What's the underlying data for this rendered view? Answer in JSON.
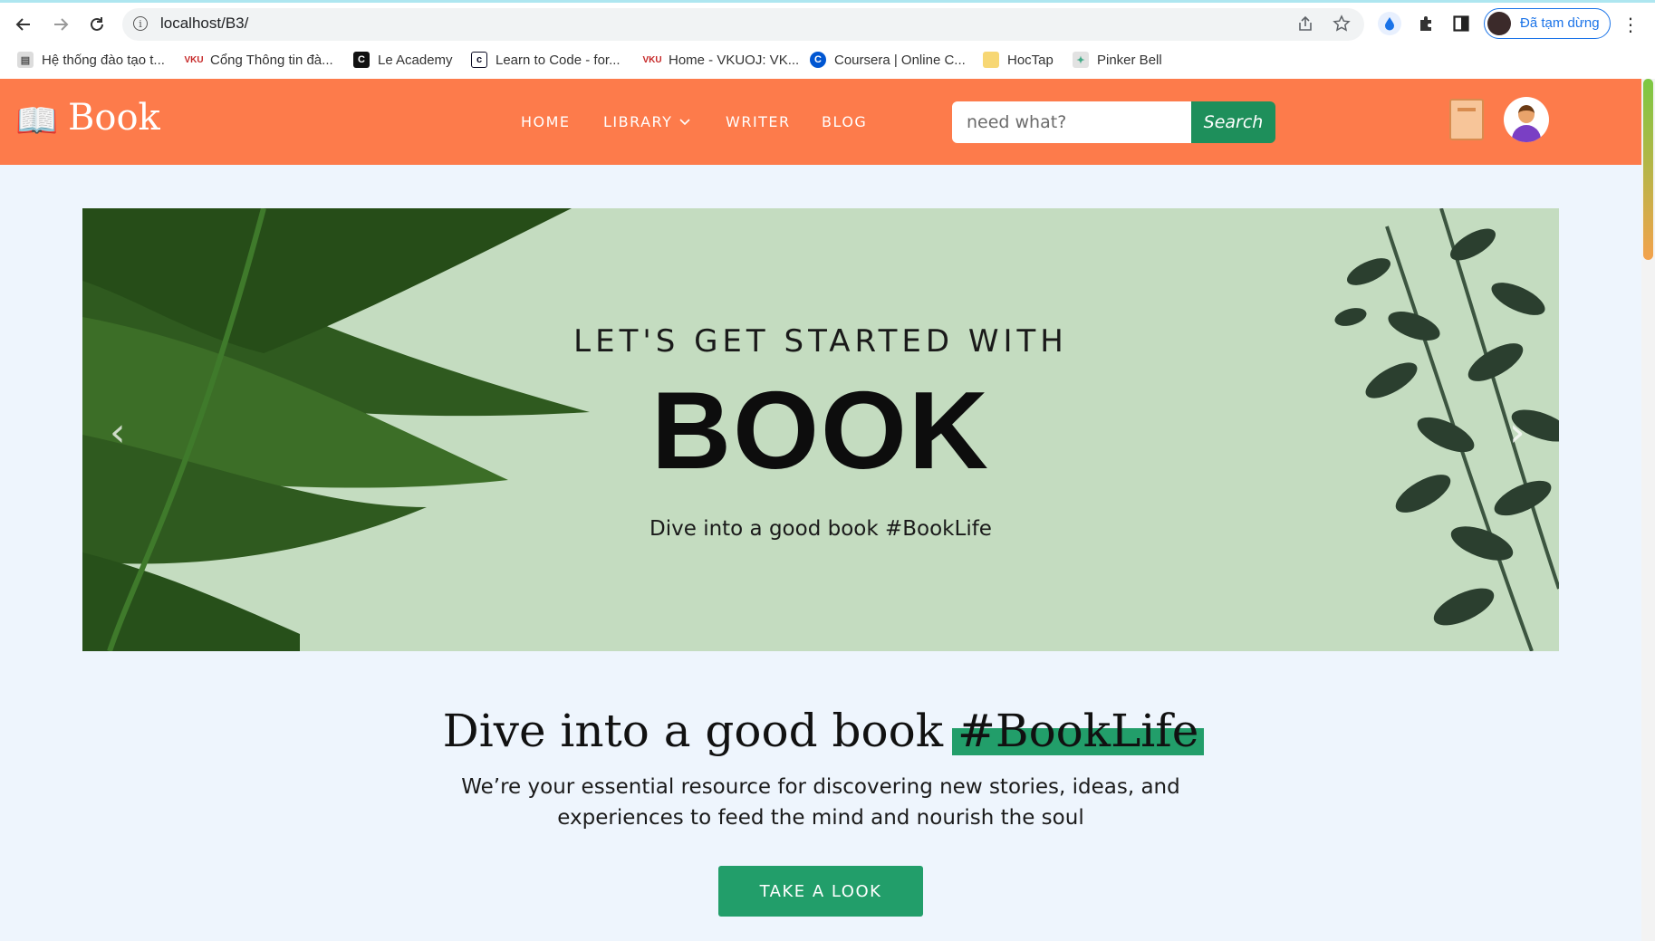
{
  "browser": {
    "url": "localhost/B3/",
    "profile_status": "Đã tạm dừng",
    "bookmarks": [
      {
        "label": "Hệ thống đào tạo t...",
        "icon": "page-icon"
      },
      {
        "label": "Cổng Thông tin đà...",
        "icon": "vku-icon"
      },
      {
        "label": "Le Academy",
        "icon": "c-icon"
      },
      {
        "label": "Learn to Code - for...",
        "icon": "code-icon"
      },
      {
        "label": "Home - VKUOJ: VK...",
        "icon": "vku-icon"
      },
      {
        "label": "Coursera | Online C...",
        "icon": "coursera-icon"
      },
      {
        "label": "HocTap",
        "icon": "folder-icon"
      },
      {
        "label": "Pinker Bell",
        "icon": "page-icon"
      }
    ]
  },
  "site": {
    "logo_icon": "📖",
    "logo_text": "Book",
    "nav": {
      "home": "HOME",
      "library": "LIBRARY",
      "writer": "WRITER",
      "blog": "BLOG"
    },
    "search": {
      "placeholder": "need what?",
      "button": "Search"
    },
    "colors": {
      "header": "#fd7b4b",
      "accent": "#229e6a",
      "search_button": "#1e8f5b",
      "background": "#eef5fd"
    }
  },
  "hero": {
    "kicker": "LET'S GET STARTED WITH",
    "title": "BOOK",
    "subtitle": "Dive into a good book #BookLife",
    "prev": "‹",
    "next": "›"
  },
  "intro": {
    "heading_main": "Dive into a good book ",
    "heading_highlight": "#BookLife",
    "description_line1": "We’re your essential resource for discovering new stories, ideas, and",
    "description_line2": "experiences to feed the mind and nourish the soul",
    "cta": "TAKE A LOOK"
  }
}
